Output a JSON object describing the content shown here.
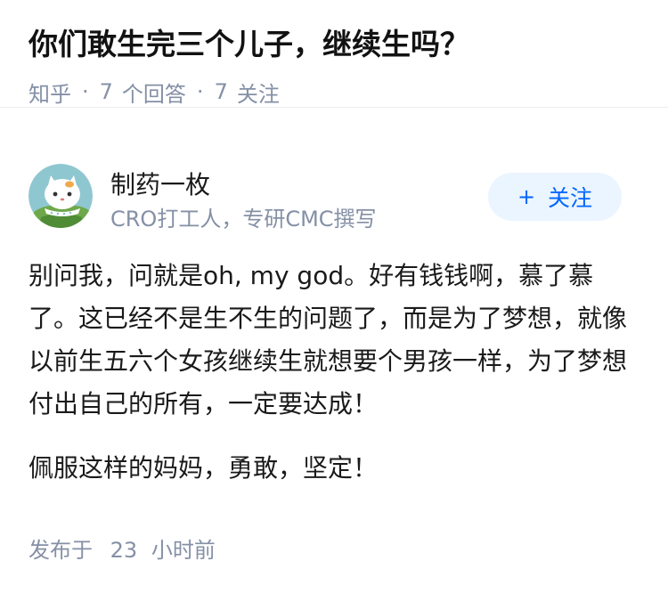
{
  "question": {
    "title": "你们敢生完三个儿子，继续生吗？",
    "source": "知乎",
    "separator": "·",
    "answers_count": "7",
    "answers_label": "个回答",
    "follows_count": "7",
    "follows_label": "关注"
  },
  "author": {
    "name": "制药一枚",
    "bio": "CRO打工人，专研CMC撰写",
    "avatar_icon": "cartoon-cat-avatar-icon",
    "follow_button": {
      "plus": "+",
      "label": "关注"
    }
  },
  "answer": {
    "paragraphs": [
      "别问我，问就是oh, my god。好有钱钱啊，慕了慕了。这已经不是生不生的问题了，而是为了梦想，就像以前生五六个女孩继续生就想要个男孩一样，为了梦想付出自己的所有，一定要达成！",
      "佩服这样的妈妈，勇敢，坚定！"
    ],
    "published_label": "发布于",
    "published_value": "23",
    "published_unit": "小时前"
  },
  "colors": {
    "accent": "#0066ff",
    "follow_bg": "#ebf5ff",
    "meta_text": "#8590a6",
    "body_text": "#1a1a1a"
  }
}
